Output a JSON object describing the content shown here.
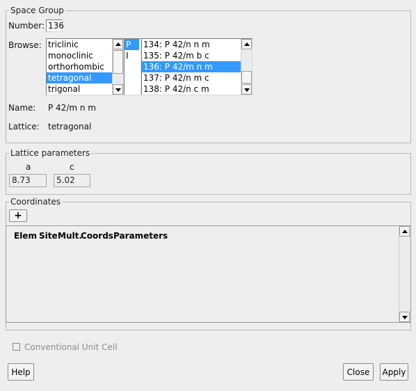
{
  "space_group": {
    "legend": "Space Group",
    "number_label": "Number:",
    "number_value": "136",
    "browse_label": "Browse:",
    "systems": [
      "triclinic",
      "monoclinic",
      "orthorhombic",
      "tetragonal",
      "trigonal"
    ],
    "selected_system": "tetragonal",
    "centering": [
      "P",
      "I"
    ],
    "selected_centering": "P",
    "groups": [
      "134: P 42/n n m",
      "135: P 42/m b c",
      "136: P 42/m n m",
      "137: P 42/n m c",
      "138: P 42/n c m"
    ],
    "selected_group": "136: P 42/m n m",
    "name_label": "Name:",
    "name_value": "P 42/m n m",
    "lattice_label": "Lattice:",
    "lattice_value": "tetragonal"
  },
  "lattice_parameters": {
    "legend": "Lattice parameters",
    "a_label": "a",
    "a_value": "8.73",
    "c_label": "c",
    "c_value": "5.02"
  },
  "coordinates": {
    "legend": "Coordinates",
    "add_label": "+",
    "columns": [
      "Elem",
      "Site",
      "Mult.",
      "Coords",
      "Parameters"
    ]
  },
  "conventional_unit_cell": {
    "label": "Conventional Unit Cell",
    "checked": false
  },
  "buttons": {
    "help": "Help",
    "close": "Close",
    "apply": "Apply"
  }
}
